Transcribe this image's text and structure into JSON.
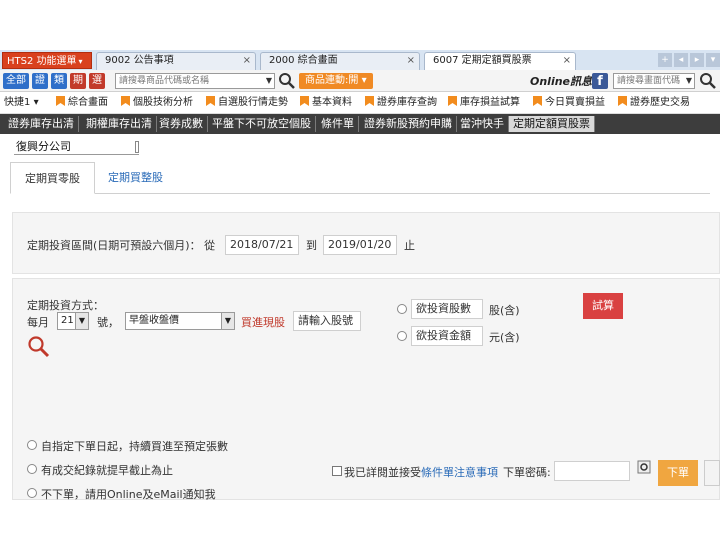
{
  "tabstrip": {
    "menu_label": "HTS2 功能選單",
    "tabs": [
      {
        "label": "9002 公告事項",
        "close": "×"
      },
      {
        "label": "2000 綜合畫面",
        "close": "×"
      },
      {
        "label": "6007 定期定額買股票",
        "close": "×"
      }
    ]
  },
  "toolbar": {
    "buttons": [
      "全部",
      "證",
      "類",
      "期",
      "選"
    ],
    "search_placeholder": "請搜尋商品代碼或名稱",
    "product_link_label": "商品連動:開",
    "online_news": "Online訊息",
    "right_search_placeholder": "請搜尋畫面代碼"
  },
  "quickbar": {
    "label": "快捷1",
    "items": [
      "綜合畫面",
      "個股技術分析",
      "自選股行情走勢",
      "基本資料",
      "證券庫存查詢",
      "庫存損益試算",
      "今日買賣損益",
      "證券歷史交易"
    ]
  },
  "functabs": [
    "證券庫存出清",
    "期權庫存出清",
    "資券成數",
    "平盤下不可放空個股",
    "條件單",
    "證券新股預約申購",
    "當沖快手",
    "定期定額買股票"
  ],
  "branch": "復興分公司",
  "subtabs": {
    "active": "定期買零股",
    "inactive": "定期買整股"
  },
  "period": {
    "label": "定期投資區間(日期可預設六個月)： 從",
    "from": "2018/07/21",
    "to_label": "到",
    "to": "2019/01/20",
    "end_label": "止"
  },
  "method": {
    "title": "定期投資方式：",
    "monthly_label": "每月",
    "day_value": "21",
    "day_suffix": "號，",
    "price_type": "早盤收盤價",
    "action_link": "買進現股",
    "stock_placeholder": "請輸入股號",
    "opt_shares_label": "欲投資股數",
    "opt_shares_unit": "股(含)",
    "opt_amount_label": "欲投資金額",
    "opt_amount_unit": "元(含)",
    "calc_button": "試算"
  },
  "options": [
    "自指定下單日起，持續買進至預定張數",
    "有成交紀錄就提早截止為止",
    "不下單，請用Online及eMail通知我"
  ],
  "confirm": {
    "prefix": "我已詳閱並接受",
    "link": "條件單注意事項",
    "password_label": "下單密碼:",
    "order_button": "下單"
  }
}
